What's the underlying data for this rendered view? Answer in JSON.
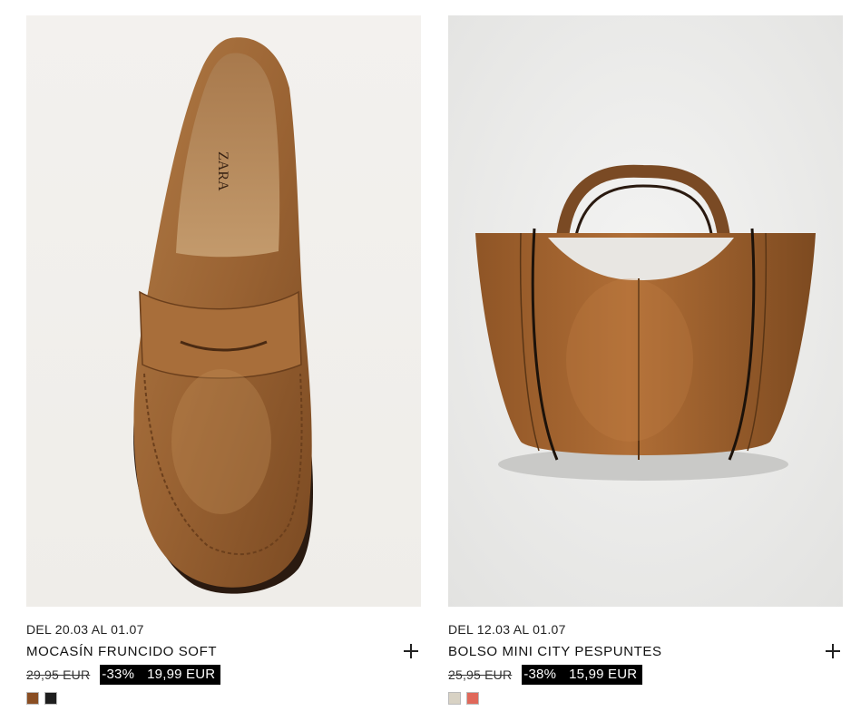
{
  "products": [
    {
      "dates": "DEL 20.03 AL 01.07",
      "name": "MOCASÍN FRUNCIDO SOFT",
      "old_price": "29,95 EUR",
      "discount": "-33%",
      "price": "19,99 EUR",
      "image_icon": "loafer-shoe-image",
      "swatches": [
        "#8a4e23",
        "#1e1e1e"
      ]
    },
    {
      "dates": "DEL 12.03 AL 01.07",
      "name": "BOLSO MINI CITY PESPUNTES",
      "old_price": "25,95 EUR",
      "discount": "-38%",
      "price": "15,99 EUR",
      "image_icon": "tote-bag-image",
      "swatches": [
        "#d8d2c4",
        "#e0685a"
      ]
    }
  ]
}
